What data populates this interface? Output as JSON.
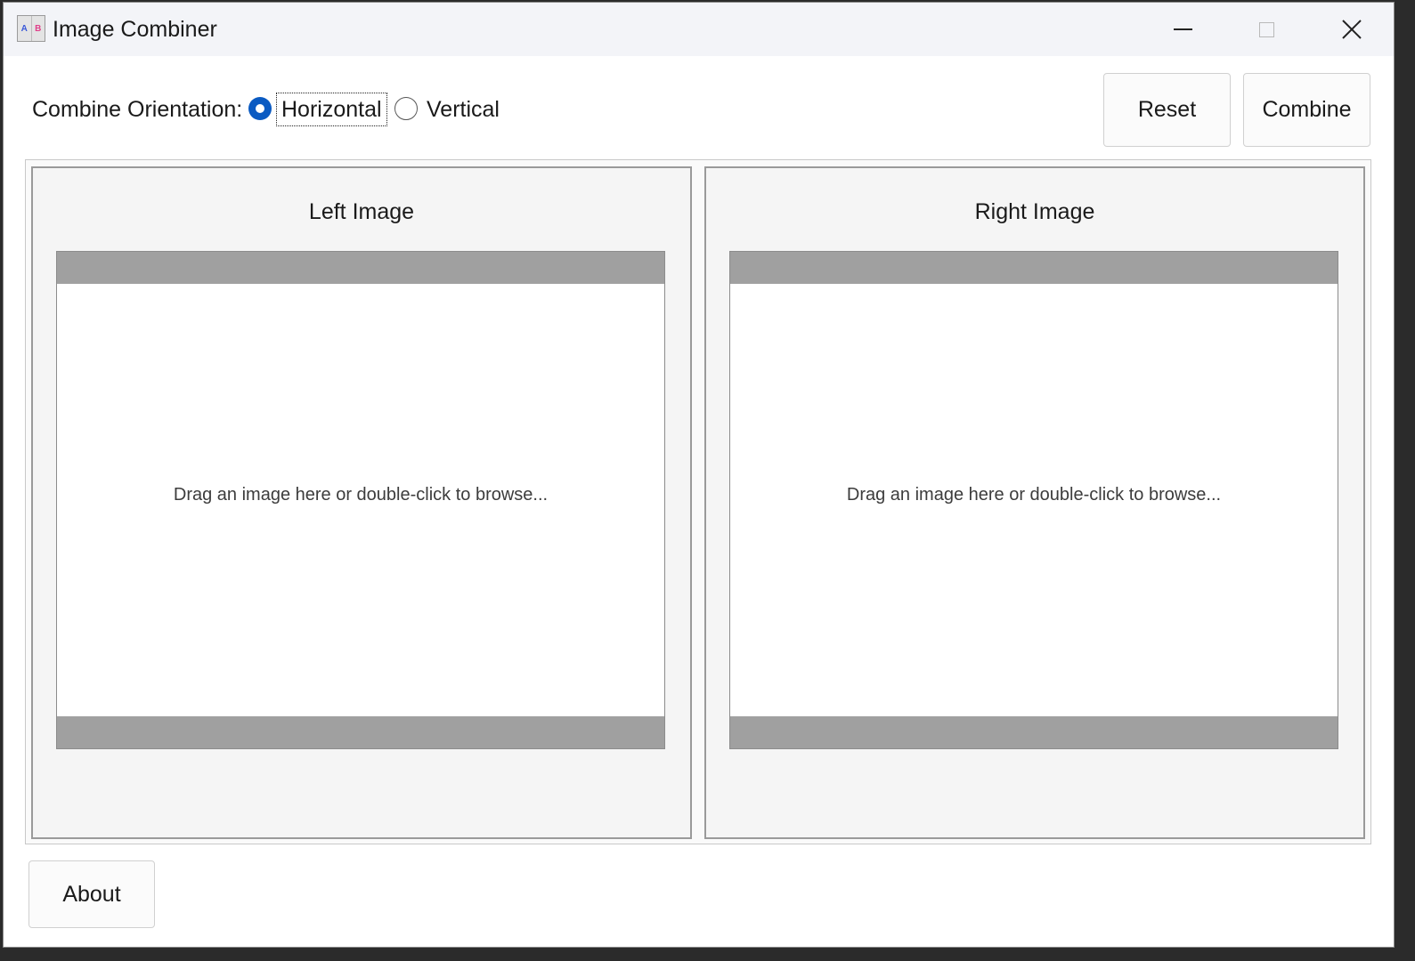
{
  "window": {
    "title": "Image Combiner",
    "icon_letters": [
      "A",
      "B"
    ],
    "controls": {
      "minimize": "minimize-icon",
      "maximize": "maximize-icon",
      "close": "close-icon"
    }
  },
  "toolbar": {
    "orientation_label": "Combine Orientation:",
    "options": [
      {
        "label": "Horizontal",
        "selected": true
      },
      {
        "label": "Vertical",
        "selected": false
      }
    ],
    "reset_label": "Reset",
    "combine_label": "Combine"
  },
  "panels": {
    "left": {
      "title": "Left Image",
      "drop_hint": "Drag an image here or double-click to browse..."
    },
    "right": {
      "title": "Right Image",
      "drop_hint": "Drag an image here or double-click to browse..."
    }
  },
  "footer": {
    "about_label": "About"
  },
  "colors": {
    "accent": "#0a5ac2",
    "drop_bar": "#a0a0a0",
    "title_bar": "#f3f4f8"
  }
}
